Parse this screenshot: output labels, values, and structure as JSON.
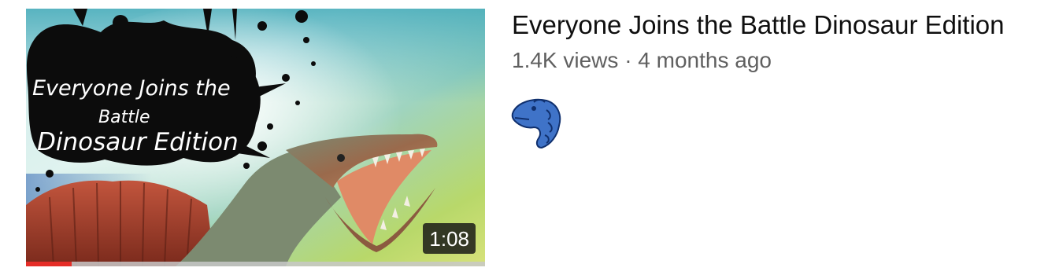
{
  "video": {
    "title": "Everyone Joins the Battle Dinosaur Edition",
    "views": "1.4K views",
    "separator": "·",
    "age": "4 months ago",
    "duration": "1:08",
    "watched_fraction": 0.1,
    "thumbnail_text_line1": "Everyone Joins the",
    "thumbnail_text_line2": "Battle",
    "thumbnail_text_line3": "Dinosaur Edition"
  },
  "channel": {
    "avatar_icon": "blue-dinosaur-avatar-icon"
  },
  "colors": {
    "title": "#0f0f0f",
    "secondary": "#606060",
    "progress": "#e52d27"
  }
}
